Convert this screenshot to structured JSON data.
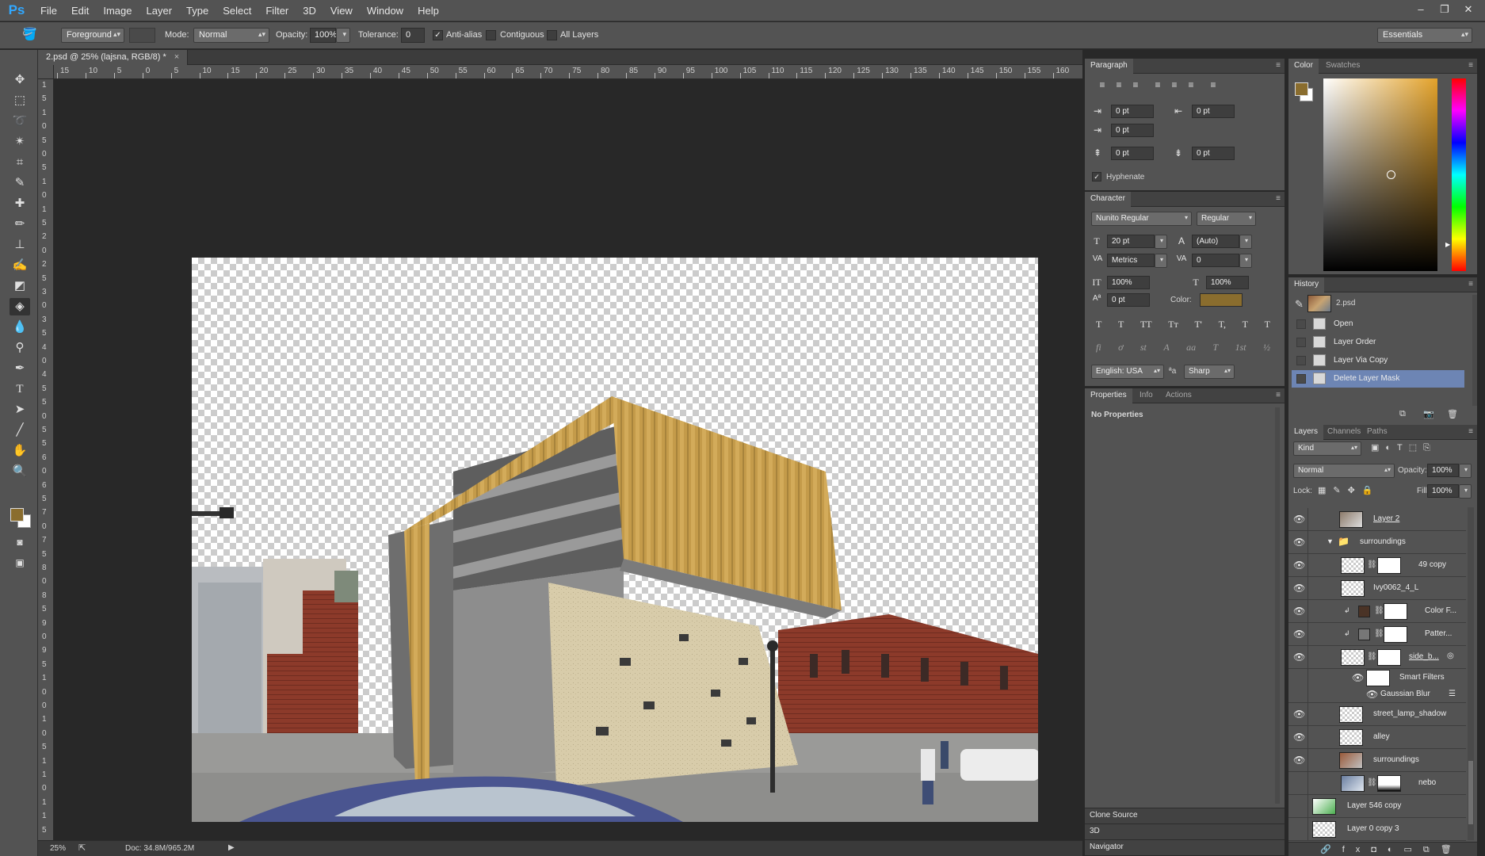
{
  "app": {
    "logo": "Ps"
  },
  "menu": [
    "File",
    "Edit",
    "Image",
    "Layer",
    "Type",
    "Select",
    "Filter",
    "3D",
    "View",
    "Window",
    "Help"
  ],
  "window_buttons": {
    "minimize": "–",
    "restore": "❐",
    "close": "✕"
  },
  "options": {
    "fill_source": "Foreground",
    "mode_label": "Mode:",
    "mode_value": "Normal",
    "opacity_label": "Opacity:",
    "opacity_value": "100%",
    "tolerance_label": "Tolerance:",
    "tolerance_value": "0",
    "antialias_label": "Anti-alias",
    "contiguous_label": "Contiguous",
    "all_layers_label": "All Layers",
    "workspace": "Essentials"
  },
  "document": {
    "tab_title": "2.psd @ 25% (lajsna, RGB/8) *",
    "close": "×",
    "ruler_h": [
      "15",
      "10",
      "5",
      "0",
      "5",
      "10",
      "15",
      "20",
      "25",
      "30",
      "35",
      "40",
      "45",
      "50",
      "55",
      "60",
      "65",
      "70",
      "75",
      "80",
      "85",
      "90",
      "95",
      "100",
      "105",
      "110",
      "115",
      "120",
      "125",
      "130",
      "135",
      "140",
      "145",
      "150",
      "155",
      "160"
    ],
    "ruler_v": [
      "1",
      "5",
      "1",
      "0",
      "5",
      "0",
      "5",
      "1",
      "0",
      "1",
      "5",
      "2",
      "0",
      "2",
      "5",
      "3",
      "0",
      "3",
      "5",
      "4",
      "0",
      "4",
      "5",
      "5",
      "0",
      "5",
      "5",
      "6",
      "0",
      "6",
      "5",
      "7",
      "0",
      "7",
      "5",
      "8",
      "0",
      "8",
      "5",
      "9",
      "0",
      "9",
      "5",
      "1",
      "0",
      "0",
      "1",
      "0",
      "5",
      "1",
      "1",
      "0",
      "1",
      "1",
      "5"
    ]
  },
  "status": {
    "zoom": "25%",
    "doc": "Doc: 34.8M/965.2M"
  },
  "paragraph": {
    "tab": "Paragraph",
    "indent_left": "0 pt",
    "indent_right": "0 pt",
    "indent_first": "0 pt",
    "space_before": "0 pt",
    "space_after": "0 pt",
    "hyphenate": "Hyphenate"
  },
  "character": {
    "tab": "Character",
    "font": "Nunito Regular",
    "style": "Regular",
    "size": "20 pt",
    "leading": "(Auto)",
    "kerning": "Metrics",
    "tracking": "0",
    "vscale": "100%",
    "hscale": "100%",
    "baseline": "0 pt",
    "color_label": "Color:",
    "color": "#8a6d2e",
    "language": "English: USA",
    "aa_label": "ªa",
    "antialias": "Sharp",
    "type_buttons": [
      "T",
      "T",
      "TT",
      "Tт",
      "T'",
      "T,",
      "T",
      "T"
    ],
    "ot_buttons": [
      "fi",
      "ơ",
      "st",
      "A",
      "aa",
      "T",
      "1st",
      "½"
    ]
  },
  "properties": {
    "tabs": [
      "Properties",
      "Info",
      "Actions"
    ],
    "empty": "No Properties"
  },
  "clone_source": "Clone Source",
  "three_d": "3D",
  "navigator": "Navigator",
  "color_panel": {
    "tabs": [
      "Color",
      "Swatches"
    ],
    "foreground": "#8a6d2e",
    "background": "#ffffff"
  },
  "history": {
    "tab": "History",
    "snapshot": "2.psd",
    "items": [
      "Open",
      "Layer Order",
      "Layer Via Copy",
      "Delete Layer Mask"
    ]
  },
  "layers": {
    "tabs": [
      "Layers",
      "Channels",
      "Paths"
    ],
    "kind": "Kind",
    "blend": "Normal",
    "opacity_label": "Opacity:",
    "opacity": "100%",
    "lock_label": "Lock:",
    "fill_label": "Fill:",
    "fill": "100%",
    "rows": [
      {
        "name": "Layer 2",
        "visible": true
      },
      {
        "name": "surroundings",
        "visible": true,
        "group": true
      },
      {
        "name": "49 copy",
        "visible": true
      },
      {
        "name": "Ivy0062_4_L",
        "visible": true
      },
      {
        "name": "Color F...",
        "visible": true
      },
      {
        "name": "Patter...",
        "visible": true
      },
      {
        "name": "side_b...",
        "visible": true
      },
      {
        "name": "Smart Filters",
        "visible": true
      },
      {
        "name": "Gaussian Blur",
        "visible": true
      },
      {
        "name": "street_lamp_shadow",
        "visible": true
      },
      {
        "name": "alley",
        "visible": true
      },
      {
        "name": "surroundings",
        "visible": true
      },
      {
        "name": "nebo",
        "visible": false
      },
      {
        "name": "Layer 546 copy",
        "visible": false
      },
      {
        "name": "Layer 0 copy 3",
        "visible": false
      }
    ]
  }
}
